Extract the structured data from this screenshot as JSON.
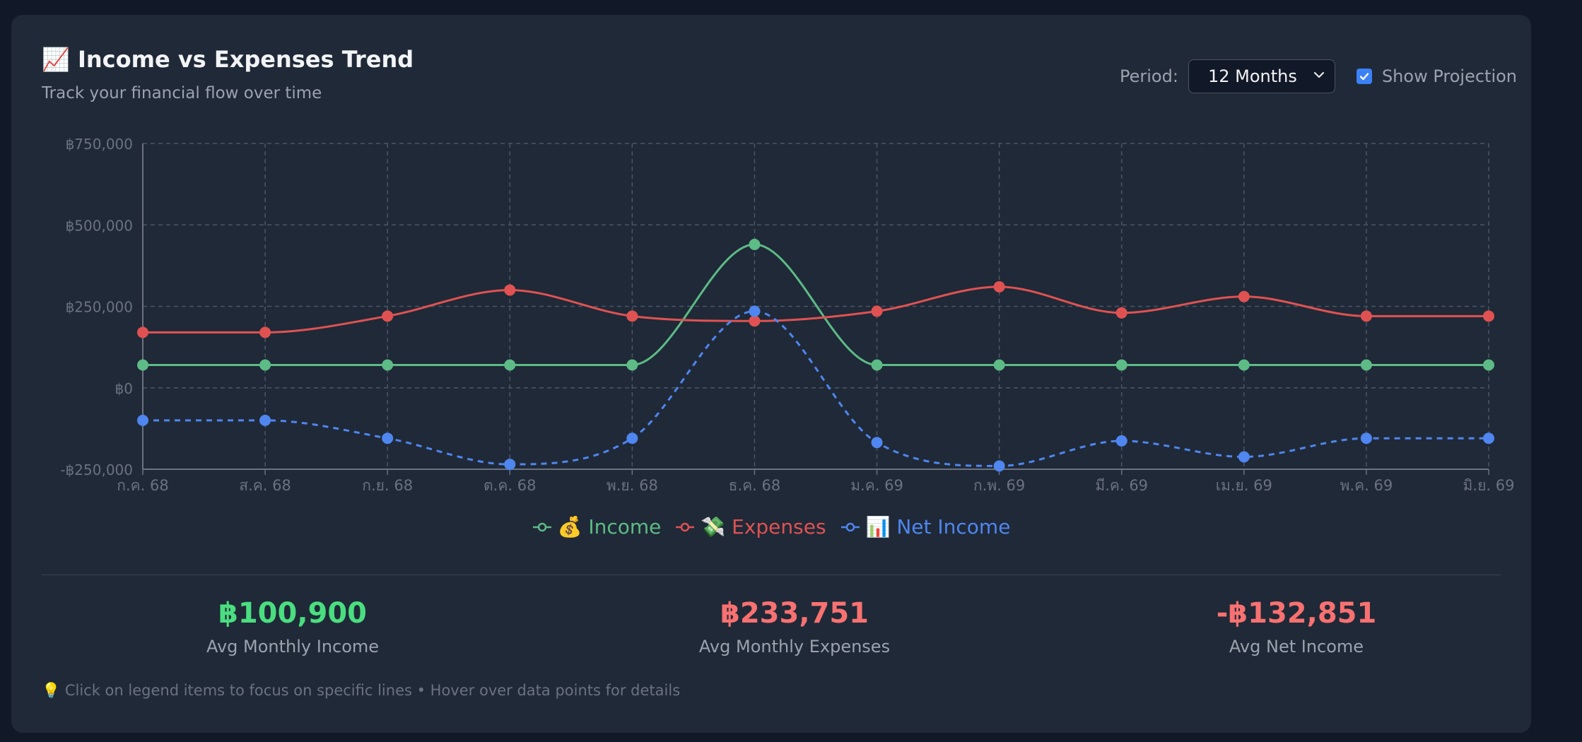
{
  "header": {
    "title_icon": "📈",
    "title": "Income vs Expenses Trend",
    "subtitle": "Track your financial flow over time"
  },
  "controls": {
    "period_label": "Period:",
    "period_value": "12 Months",
    "projection_label": "Show Projection",
    "projection_checked": true
  },
  "chart_data": {
    "type": "line",
    "categories": [
      "ก.ค. 68",
      "ส.ค. 68",
      "ก.ย. 68",
      "ต.ค. 68",
      "พ.ย. 68",
      "ธ.ค. 68",
      "ม.ค. 69",
      "ก.พ. 69",
      "มี.ค. 69",
      "เม.ย. 69",
      "พ.ค. 69",
      "มิ.ย. 69"
    ],
    "yticks": [
      "฿750,000",
      "฿500,000",
      "฿250,000",
      "฿0",
      "-฿250,000"
    ],
    "ylim": [
      -250000,
      750000
    ],
    "grid": true,
    "legend_position": "bottom",
    "series": [
      {
        "name": "Income",
        "icon": "💰",
        "color": "#5dbb86",
        "dashed": false,
        "values": [
          70000,
          70000,
          70000,
          70000,
          70000,
          440000,
          70000,
          70000,
          70000,
          70000,
          70000,
          70000
        ]
      },
      {
        "name": "Expenses",
        "icon": "💸",
        "color": "#e05252",
        "dashed": false,
        "values": [
          170000,
          170000,
          220000,
          300000,
          220000,
          205000,
          235000,
          310000,
          230000,
          280000,
          220000,
          220000
        ]
      },
      {
        "name": "Net Income",
        "icon": "📊",
        "color": "#4f86f0",
        "dashed": true,
        "values": [
          -100000,
          -100000,
          -155000,
          -235000,
          -155000,
          235000,
          -168000,
          -240000,
          -163000,
          -212000,
          -155000,
          -155000
        ]
      }
    ]
  },
  "stats": [
    {
      "value": "฿100,900",
      "label": "Avg Monthly Income",
      "color": "#4ade80"
    },
    {
      "value": "฿233,751",
      "label": "Avg Monthly Expenses",
      "color": "#f87171"
    },
    {
      "value": "-฿132,851",
      "label": "Avg Net Income",
      "color": "#f87171"
    }
  ],
  "footer": {
    "icon": "💡",
    "text": "Click on legend items to focus on specific lines • Hover over data points for details"
  }
}
